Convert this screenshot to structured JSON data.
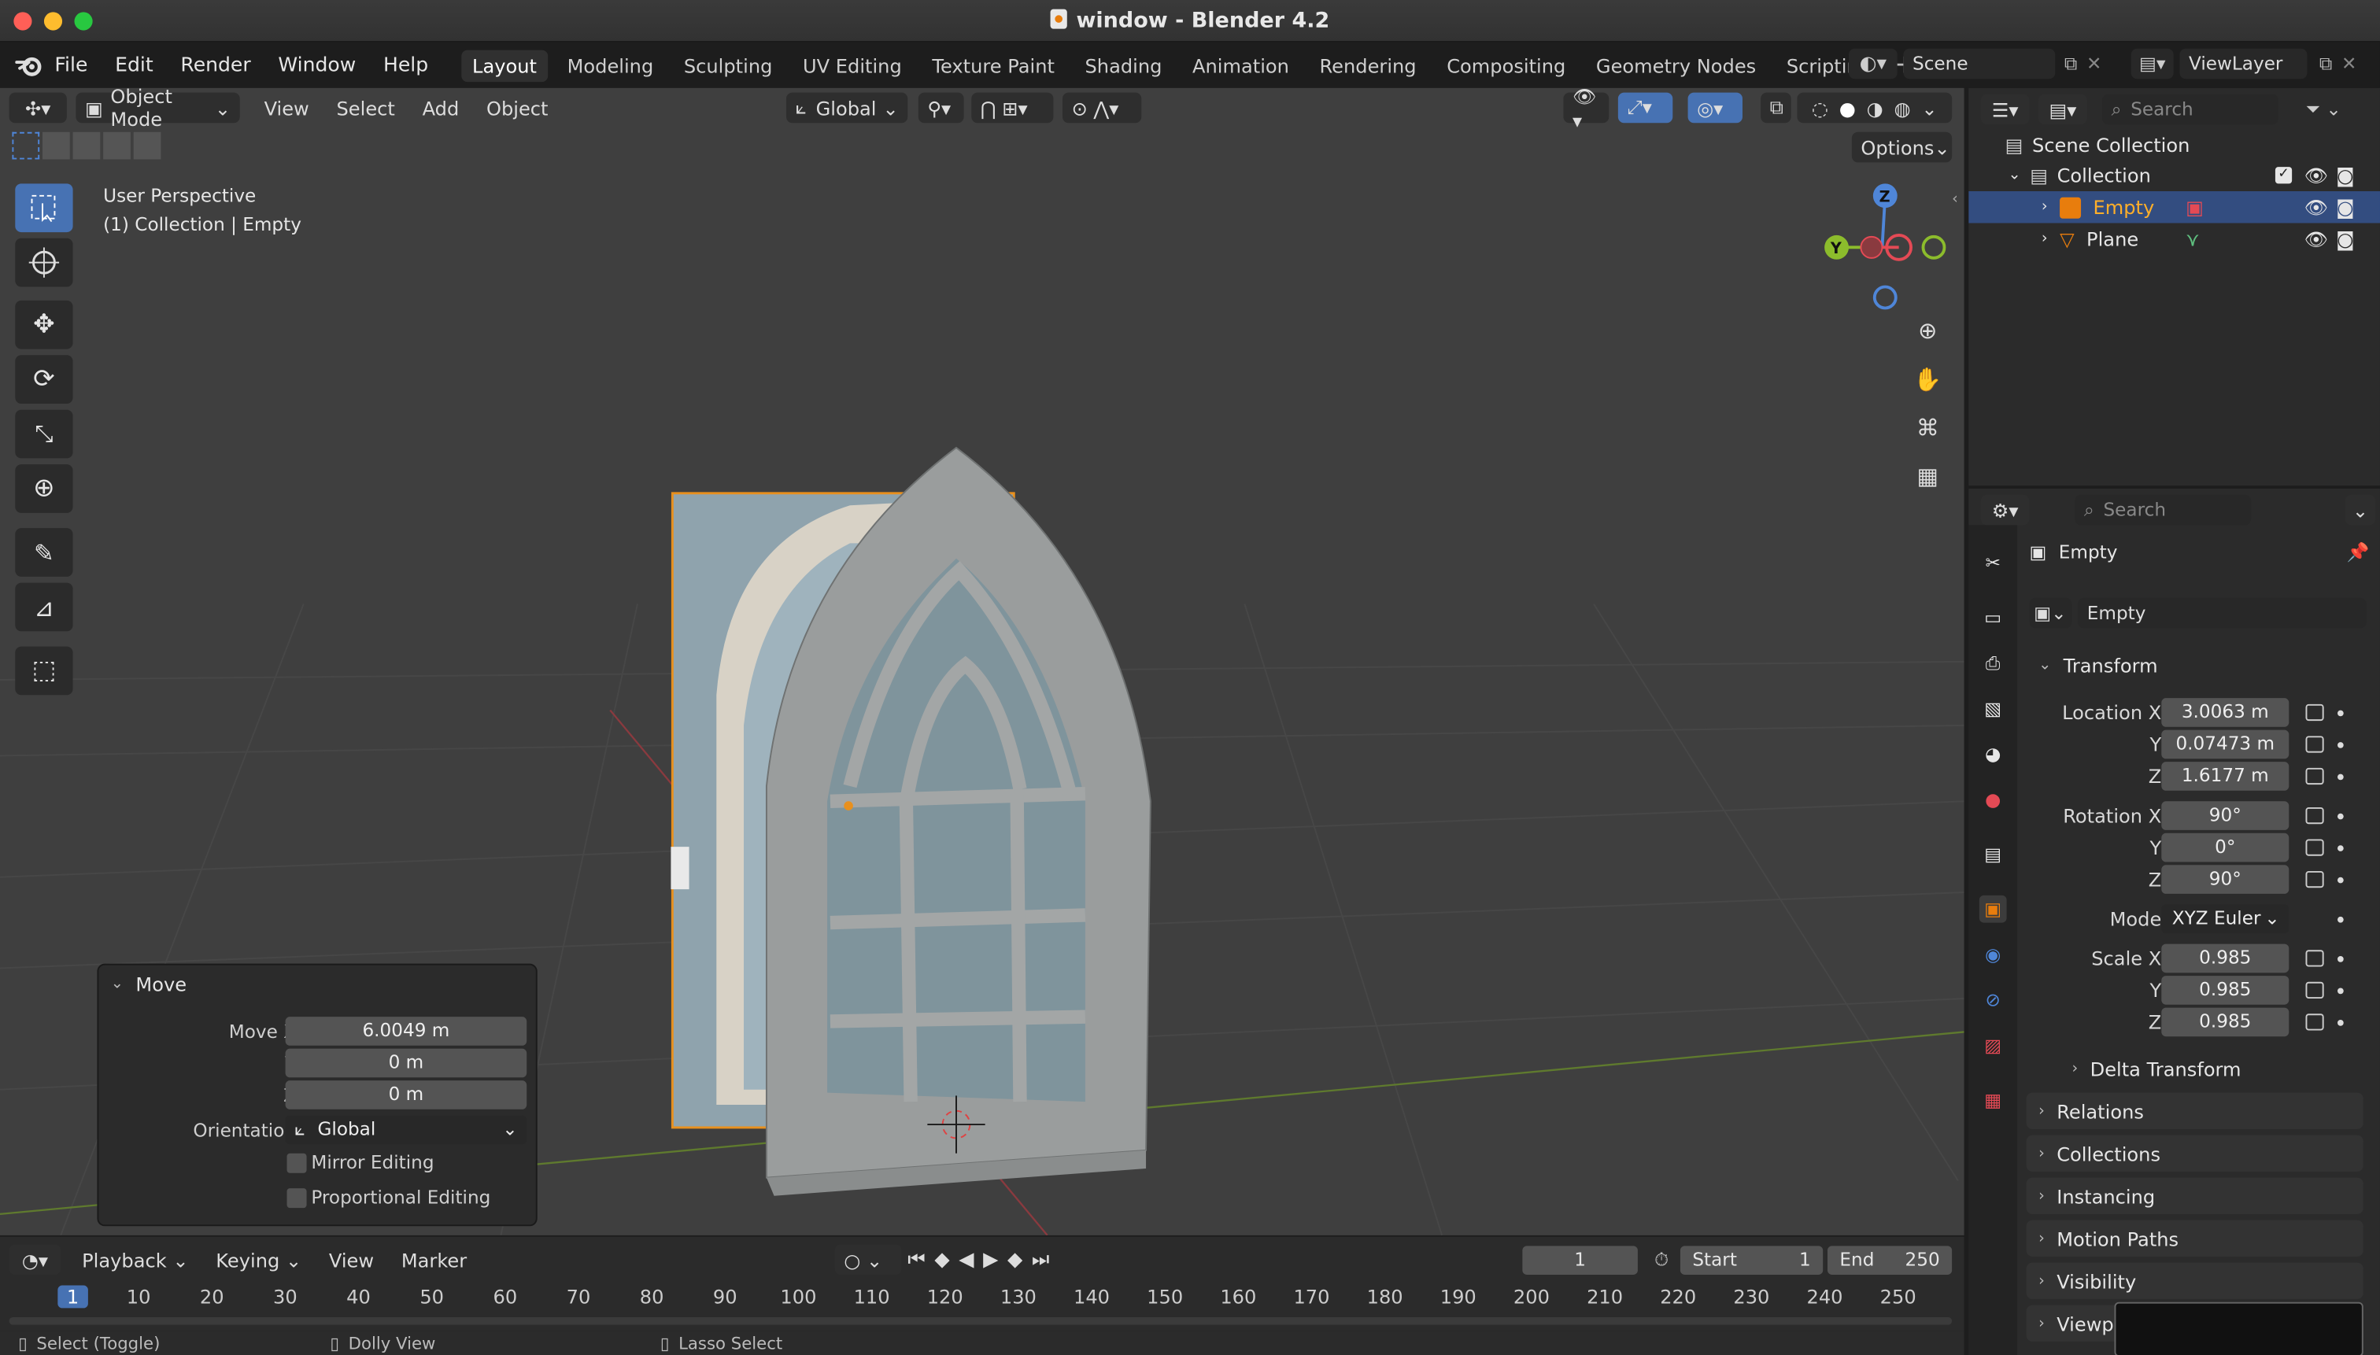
{
  "window": {
    "title": "window - Blender 4.2"
  },
  "menu": {
    "file": "File",
    "edit": "Edit",
    "render": "Render",
    "window": "Window",
    "help": "Help"
  },
  "workspaces": [
    "Layout",
    "Modeling",
    "Sculpting",
    "UV Editing",
    "Texture Paint",
    "Shading",
    "Animation",
    "Rendering",
    "Compositing",
    "Geometry Nodes",
    "Scripting"
  ],
  "active_workspace": "Layout",
  "scene": {
    "name": "Scene",
    "view_layer": "ViewLayer"
  },
  "viewport": {
    "mode": "Object Mode",
    "menus": {
      "view": "View",
      "select": "Select",
      "add": "Add",
      "object": "Object"
    },
    "orientation": "Global",
    "options_label": "Options",
    "info_line1": "User Perspective",
    "info_line2": "(1) Collection | Empty",
    "gizmo": {
      "z": "Z",
      "y": "Y"
    }
  },
  "move_panel": {
    "title": "Move",
    "move_x_label": "Move X",
    "move_x": "6.0049 m",
    "y_label": "Y",
    "y": "0 m",
    "z_label": "Z",
    "z": "0 m",
    "orientation_label": "Orientation",
    "orientation": "Global",
    "mirror_editing": "Mirror Editing",
    "proportional_editing": "Proportional Editing"
  },
  "timeline": {
    "playback": "Playback",
    "keying": "Keying",
    "view": "View",
    "marker": "Marker",
    "current_frame": "1",
    "start_label": "Start",
    "start": "1",
    "end_label": "End",
    "end": "250",
    "ticks": [
      "1",
      "10",
      "20",
      "30",
      "40",
      "50",
      "60",
      "70",
      "80",
      "90",
      "100",
      "110",
      "120",
      "130",
      "140",
      "150",
      "160",
      "170",
      "180",
      "190",
      "200",
      "210",
      "220",
      "230",
      "240",
      "250"
    ]
  },
  "statusbar": {
    "select": "Select (Toggle)",
    "dolly": "Dolly View",
    "lasso": "Lasso Select"
  },
  "outliner": {
    "search_placeholder": "Search",
    "scene_collection": "Scene Collection",
    "collection": "Collection",
    "items": [
      {
        "name": "Empty",
        "selected": true
      },
      {
        "name": "Plane",
        "selected": false
      }
    ]
  },
  "properties": {
    "search_placeholder": "Search",
    "object_name": "Empty",
    "object_field": "Empty",
    "transform": "Transform",
    "location_label": "Location X",
    "location_x": "3.0063 m",
    "location_y_label": "Y",
    "location_y": "0.07473 m",
    "location_z_label": "Z",
    "location_z": "1.6177 m",
    "rotation_label": "Rotation X",
    "rotation_x": "90°",
    "rotation_y_label": "Y",
    "rotation_y": "0°",
    "rotation_z_label": "Z",
    "rotation_z": "90°",
    "mode_label": "Mode",
    "mode": "XYZ Euler",
    "scale_label": "Scale X",
    "scale_x": "0.985",
    "scale_y_label": "Y",
    "scale_y": "0.985",
    "scale_z_label": "Z",
    "scale_z": "0.985",
    "delta_transform": "Delta Transform",
    "sections": [
      "Relations",
      "Collections",
      "Instancing",
      "Motion Paths",
      "Visibility",
      "Viewp"
    ]
  },
  "colors": {
    "accent": "#4772b3",
    "selection": "#334d80",
    "origin": "#e87d0d",
    "x_axis": "#e44a55",
    "y_axis": "#8cbc2c",
    "z_axis": "#4f86d8"
  }
}
